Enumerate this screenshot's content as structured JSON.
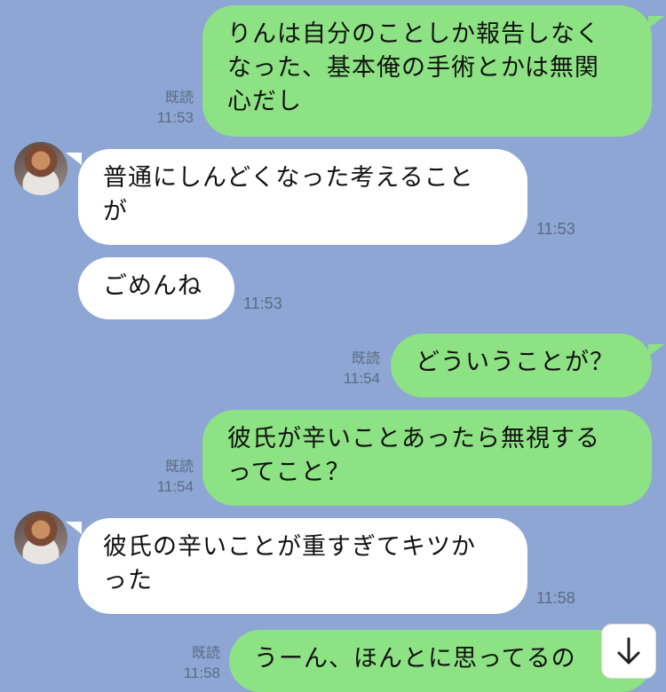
{
  "chat": {
    "messages": [
      {
        "side": "out",
        "read": "既読",
        "time": "11:53",
        "text": "りんは自分のことしか報告しなく\nなった、基本俺の手術とかは無関\n心だし"
      },
      {
        "side": "in",
        "time": "11:53",
        "text": "普通にしんどくなった考えること\nが"
      },
      {
        "side": "in",
        "time": "11:53",
        "text": "ごめんね"
      },
      {
        "side": "out",
        "read": "既読",
        "time": "11:54",
        "text": "どういうことが？"
      },
      {
        "side": "out",
        "read": "既読",
        "time": "11:54",
        "text": "彼氏が辛いことあったら無視する\nってこと？"
      },
      {
        "side": "in",
        "time": "11:58",
        "text": "彼氏の辛いことが重すぎてキツか\nった"
      },
      {
        "side": "out",
        "read": "既読",
        "time": "11:58",
        "text": "うーん、ほんとに思ってるの"
      }
    ]
  },
  "scroll_button": {
    "icon": "arrow-down-icon"
  }
}
